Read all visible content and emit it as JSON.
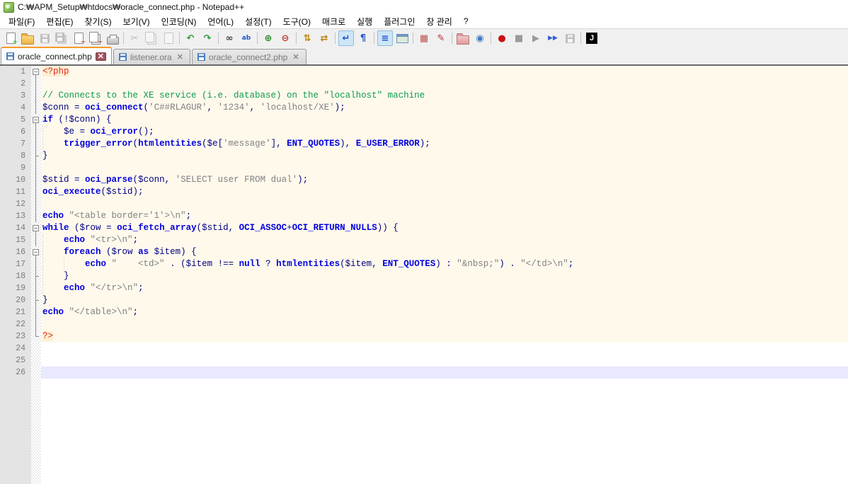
{
  "window": {
    "title": "C:₩APM_Setup₩htdocs₩oracle_connect.php - Notepad++",
    "app_icon": "notepad-plus-plus-icon"
  },
  "menu": {
    "items": [
      "파일(F)",
      "편집(E)",
      "찾기(S)",
      "보기(V)",
      "인코딩(N)",
      "언어(L)",
      "설정(T)",
      "도구(O)",
      "매크로",
      "실행",
      "플러그인",
      "창 관리",
      "?"
    ]
  },
  "toolbar": {
    "items": [
      {
        "name": "new-file",
        "shape": "page",
        "badge": "+",
        "badge_color": "#2fae3e"
      },
      {
        "name": "open-file",
        "shape": "folder"
      },
      {
        "name": "save-file",
        "shape": "floppy",
        "disabled": true
      },
      {
        "name": "save-all",
        "shape": "floppy2",
        "disabled": true
      },
      {
        "name": "close-file",
        "shape": "page",
        "badge": "−",
        "badge_color": "#d9342b"
      },
      {
        "name": "close-all",
        "shape": "pages",
        "badge": "−",
        "badge_color": "#d9342b"
      },
      {
        "name": "print",
        "shape": "printer"
      },
      {
        "sep": true
      },
      {
        "name": "cut",
        "glyph": "✂",
        "color": "#666",
        "disabled": true
      },
      {
        "name": "copy",
        "shape": "pages",
        "disabled": true
      },
      {
        "name": "paste",
        "shape": "page",
        "disabled": true
      },
      {
        "sep": true
      },
      {
        "name": "undo",
        "glyph": "↶",
        "color": "#2f9e3f"
      },
      {
        "name": "redo",
        "glyph": "↷",
        "color": "#2f9e3f"
      },
      {
        "sep": true
      },
      {
        "name": "find",
        "glyph": "∞",
        "color": "#444"
      },
      {
        "name": "replace",
        "glyph": "ab",
        "color": "#2255cc"
      },
      {
        "sep": true
      },
      {
        "name": "zoom-in",
        "glyph": "⊕",
        "color": "#2e8b2e"
      },
      {
        "name": "zoom-out",
        "glyph": "⊖",
        "color": "#c0392b"
      },
      {
        "sep": true
      },
      {
        "name": "sync-vertical-scroll",
        "glyph": "⇅",
        "color": "#b8860b"
      },
      {
        "name": "sync-horizontal-scroll",
        "glyph": "⇄",
        "color": "#b8860b"
      },
      {
        "sep": true
      },
      {
        "name": "word-wrap",
        "glyph": "↵",
        "color": "#2255cc",
        "pressed": true
      },
      {
        "name": "show-all-characters",
        "glyph": "¶",
        "color": "#2255cc"
      },
      {
        "sep": true
      },
      {
        "name": "show-indent-guide",
        "glyph": "≡",
        "color": "#2255cc",
        "pressed": true
      },
      {
        "name": "user-define-dialog",
        "shape": "window"
      },
      {
        "sep": true
      },
      {
        "name": "document-map",
        "glyph": "▦",
        "color": "#c05050"
      },
      {
        "name": "function-list",
        "glyph": "✎",
        "color": "#c03030"
      },
      {
        "sep": true
      },
      {
        "name": "folder-as-workspace",
        "shape": "folderp"
      },
      {
        "name": "monitoring",
        "glyph": "◉",
        "color": "#3a78c2"
      },
      {
        "sep": true
      },
      {
        "name": "macro-record",
        "glyph": "●",
        "color": "#cc1111"
      },
      {
        "name": "macro-stop",
        "glyph": "■",
        "color": "#9a9a9a"
      },
      {
        "name": "macro-play",
        "glyph": "▶",
        "color": "#9a9a9a"
      },
      {
        "name": "macro-run-multiple",
        "glyph": "▶▶",
        "color": "#2f5fd0"
      },
      {
        "name": "macro-save",
        "shape": "floppy",
        "disabled": true
      },
      {
        "sep": true
      },
      {
        "name": "jstool-plugin",
        "glyph": "J",
        "shape": "dark",
        "color": "#ffffff"
      }
    ]
  },
  "tabs": [
    {
      "label": "oracle_connect.php",
      "active": true,
      "close": "✕"
    },
    {
      "label": "listener.ora",
      "active": false,
      "close": "✕"
    },
    {
      "label": "oracle_connect2.php",
      "active": false,
      "close": "✕"
    }
  ],
  "editor": {
    "colors": {
      "php_section_bg": "#FFF9EC",
      "php_tag_bg": "#FCEFD2",
      "php_tag_fg": "#E02A1C",
      "comment": "#0E9A4A",
      "string": "#808080",
      "keyword": "#0000E0",
      "variable": "#000080",
      "current_line_bg": "#E8E8FF",
      "line_number_fg": "#7B7B7B",
      "margin_bg": "#E4E4E4",
      "active_tab_accent": "#F79A28"
    },
    "lines": [
      {
        "n": 1,
        "fold": "minus",
        "bg": "php",
        "seg": [
          [
            "tag",
            "<?php"
          ]
        ]
      },
      {
        "n": 2,
        "fold": "line",
        "bg": "php",
        "seg": []
      },
      {
        "n": 3,
        "fold": "line",
        "bg": "php",
        "seg": [
          [
            "com",
            "// Connects to the XE service (i.e. database) on the \"localhost\" machine"
          ]
        ]
      },
      {
        "n": 4,
        "fold": "line",
        "bg": "php",
        "seg": [
          [
            "var",
            "$conn"
          ],
          [
            "pun",
            " = "
          ],
          [
            "fn",
            "oci_connect"
          ],
          [
            "pun",
            "("
          ],
          [
            "str",
            "'C##RLAGUR'"
          ],
          [
            "pun",
            ", "
          ],
          [
            "str",
            "'1234'"
          ],
          [
            "pun",
            ", "
          ],
          [
            "str",
            "'localhost/XE'"
          ],
          [
            "pun",
            ");"
          ]
        ]
      },
      {
        "n": 5,
        "fold": "minus",
        "bg": "php",
        "seg": [
          [
            "kw",
            "if"
          ],
          [
            "pun",
            " (!"
          ],
          [
            "var",
            "$conn"
          ],
          [
            "pun",
            ") {"
          ]
        ]
      },
      {
        "n": 6,
        "fold": "line",
        "bg": "php",
        "seg": [
          [
            "pun",
            "    "
          ],
          [
            "var",
            "$e"
          ],
          [
            "pun",
            " = "
          ],
          [
            "fn",
            "oci_error"
          ],
          [
            "pun",
            "();"
          ]
        ]
      },
      {
        "n": 7,
        "fold": "line",
        "bg": "php",
        "seg": [
          [
            "pun",
            "    "
          ],
          [
            "fn",
            "trigger_error"
          ],
          [
            "pun",
            "("
          ],
          [
            "fn",
            "htmlentities"
          ],
          [
            "pun",
            "("
          ],
          [
            "var",
            "$e"
          ],
          [
            "pun",
            "["
          ],
          [
            "str",
            "'message'"
          ],
          [
            "pun",
            "], "
          ],
          [
            "cst",
            "ENT_QUOTES"
          ],
          [
            "pun",
            "), "
          ],
          [
            "cst",
            "E_USER_ERROR"
          ],
          [
            "pun",
            ");"
          ]
        ]
      },
      {
        "n": 8,
        "fold": "tee",
        "bg": "php",
        "seg": [
          [
            "pun",
            "}"
          ]
        ]
      },
      {
        "n": 9,
        "fold": "line",
        "bg": "php",
        "seg": []
      },
      {
        "n": 10,
        "fold": "line",
        "bg": "php",
        "seg": [
          [
            "var",
            "$stid"
          ],
          [
            "pun",
            " = "
          ],
          [
            "fn",
            "oci_parse"
          ],
          [
            "pun",
            "("
          ],
          [
            "var",
            "$conn"
          ],
          [
            "pun",
            ", "
          ],
          [
            "str",
            "'SELECT user FROM dual'"
          ],
          [
            "pun",
            ");"
          ]
        ]
      },
      {
        "n": 11,
        "fold": "line",
        "bg": "php",
        "seg": [
          [
            "fn",
            "oci_execute"
          ],
          [
            "pun",
            "("
          ],
          [
            "var",
            "$stid"
          ],
          [
            "pun",
            ");"
          ]
        ]
      },
      {
        "n": 12,
        "fold": "line",
        "bg": "php",
        "seg": []
      },
      {
        "n": 13,
        "fold": "line",
        "bg": "php",
        "seg": [
          [
            "kw",
            "echo"
          ],
          [
            "pun",
            " "
          ],
          [
            "str",
            "\"<table border='1'>\\n\""
          ],
          [
            "pun",
            ";"
          ]
        ]
      },
      {
        "n": 14,
        "fold": "minus",
        "bg": "php",
        "seg": [
          [
            "kw",
            "while"
          ],
          [
            "pun",
            " ("
          ],
          [
            "var",
            "$row"
          ],
          [
            "pun",
            " = "
          ],
          [
            "fn",
            "oci_fetch_array"
          ],
          [
            "pun",
            "("
          ],
          [
            "var",
            "$stid"
          ],
          [
            "pun",
            ", "
          ],
          [
            "cst",
            "OCI_ASSOC"
          ],
          [
            "pun",
            "+"
          ],
          [
            "cst",
            "OCI_RETURN_NULLS"
          ],
          [
            "pun",
            ")) {"
          ]
        ]
      },
      {
        "n": 15,
        "fold": "line",
        "bg": "php",
        "seg": [
          [
            "pun",
            "    "
          ],
          [
            "kw",
            "echo"
          ],
          [
            "pun",
            " "
          ],
          [
            "str",
            "\"<tr>\\n\""
          ],
          [
            "pun",
            ";"
          ]
        ]
      },
      {
        "n": 16,
        "fold": "minus",
        "bg": "php",
        "seg": [
          [
            "pun",
            "    "
          ],
          [
            "kw",
            "foreach"
          ],
          [
            "pun",
            " ("
          ],
          [
            "var",
            "$row"
          ],
          [
            "kw",
            " as "
          ],
          [
            "var",
            "$item"
          ],
          [
            "pun",
            ") {"
          ]
        ]
      },
      {
        "n": 17,
        "fold": "line",
        "bg": "php",
        "seg": [
          [
            "pun",
            "        "
          ],
          [
            "kw",
            "echo"
          ],
          [
            "pun",
            " "
          ],
          [
            "str",
            "\"    <td>\""
          ],
          [
            "pun",
            " . ("
          ],
          [
            "var",
            "$item"
          ],
          [
            "pun",
            " !== "
          ],
          [
            "kw",
            "null"
          ],
          [
            "pun",
            " ? "
          ],
          [
            "fn",
            "htmlentities"
          ],
          [
            "pun",
            "("
          ],
          [
            "var",
            "$item"
          ],
          [
            "pun",
            ", "
          ],
          [
            "cst",
            "ENT_QUOTES"
          ],
          [
            "pun",
            ") : "
          ],
          [
            "str",
            "\"&nbsp;\""
          ],
          [
            "pun",
            ") . "
          ],
          [
            "str",
            "\"</td>\\n\""
          ],
          [
            "pun",
            ";"
          ]
        ]
      },
      {
        "n": 18,
        "fold": "tee",
        "bg": "php",
        "seg": [
          [
            "pun",
            "    }"
          ]
        ]
      },
      {
        "n": 19,
        "fold": "line",
        "bg": "php",
        "seg": [
          [
            "pun",
            "    "
          ],
          [
            "kw",
            "echo"
          ],
          [
            "pun",
            " "
          ],
          [
            "str",
            "\"</tr>\\n\""
          ],
          [
            "pun",
            ";"
          ]
        ]
      },
      {
        "n": 20,
        "fold": "tee",
        "bg": "php",
        "seg": [
          [
            "pun",
            "}"
          ]
        ]
      },
      {
        "n": 21,
        "fold": "line",
        "bg": "php",
        "seg": [
          [
            "kw",
            "echo"
          ],
          [
            "pun",
            " "
          ],
          [
            "str",
            "\"</table>\\n\""
          ],
          [
            "pun",
            ";"
          ]
        ]
      },
      {
        "n": 22,
        "fold": "line",
        "bg": "php",
        "seg": []
      },
      {
        "n": 23,
        "fold": "end",
        "bg": "php",
        "seg": [
          [
            "tag",
            "?>"
          ]
        ]
      },
      {
        "n": 24,
        "fold": "",
        "bg": "plain",
        "seg": []
      },
      {
        "n": 25,
        "fold": "",
        "bg": "plain",
        "seg": []
      },
      {
        "n": 26,
        "fold": "",
        "bg": "current",
        "seg": []
      }
    ]
  }
}
